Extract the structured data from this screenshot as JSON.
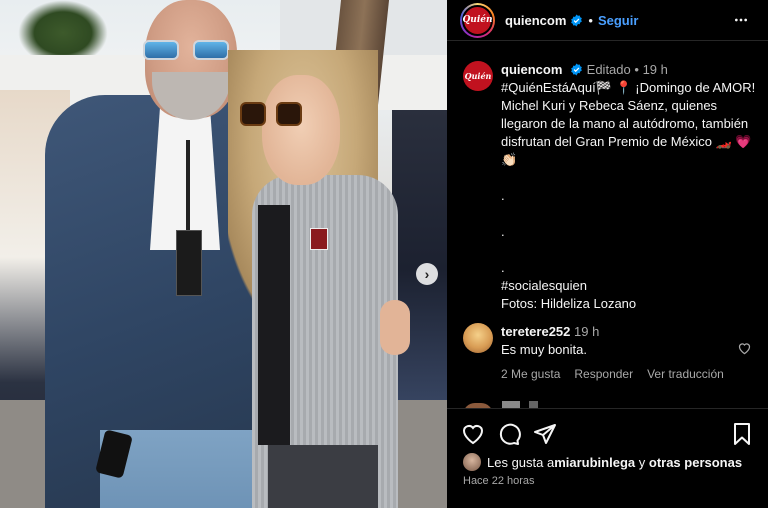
{
  "post": {
    "carousel_next": "›"
  },
  "header": {
    "avatar_text": "Quién",
    "username": "quiencom",
    "separator": "•",
    "follow": "Seguir"
  },
  "caption": {
    "avatar_text": "Quién",
    "username": "quiencom",
    "edited": "Editado",
    "separator": "•",
    "time": "19 h",
    "text": "#QuiénEstáAquí🏁 📍 ¡Domingo de AMOR! Michel Kuri y Rebeca Sáenz, quienes llegaron de la mano al autódromo, también disfrutan del Gran Premio de México 🏎️ 💗 👏🏻\n\n.\n\n.\n\n.\n#socialesquien\nFotos: Hildeliza Lozano"
  },
  "comment": {
    "username": "teretere252",
    "time": "19 h",
    "text": "Es muy bonita.",
    "likes": "2 Me gusta",
    "reply": "Responder",
    "translate": "Ver traducción"
  },
  "likes": {
    "prefix": "Les gusta a ",
    "user": "miarubinlega",
    "middle": " y ",
    "others": "otras personas"
  },
  "timestamp": "Hace 22 horas",
  "icons": {
    "verified": "verified-badge-icon",
    "more": "more-options-icon",
    "like": "heart-icon",
    "comment": "comment-icon",
    "share": "share-icon",
    "save": "bookmark-icon",
    "comment_like": "heart-icon",
    "carousel": "chevron-right-icon"
  },
  "colors": {
    "background": "#000000",
    "text": "#f5f5f5",
    "muted": "#a8a8a8",
    "link": "#4a9fff",
    "brand": "#c1121f"
  }
}
